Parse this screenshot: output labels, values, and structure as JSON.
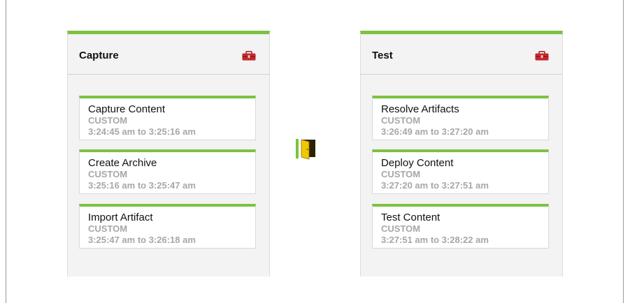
{
  "colors": {
    "accent_green": "#7cc242",
    "panel_bg": "#f3f3f3",
    "muted_text": "#a7a7a7",
    "toolbox_red": "#c8272e",
    "gate_yellow": "#e8c100"
  },
  "icons": {
    "stage_tool": "toolbox-icon",
    "gate": "door-gate-icon"
  },
  "stages": [
    {
      "title": "Capture",
      "jobs": [
        {
          "name": "Capture Content",
          "type": "CUSTOM",
          "time": "3:24:45 am to 3:25:16 am"
        },
        {
          "name": "Create Archive",
          "type": "CUSTOM",
          "time": "3:25:16 am to 3:25:47 am"
        },
        {
          "name": "Import Artifact",
          "type": "CUSTOM",
          "time": "3:25:47 am to 3:26:18 am"
        }
      ]
    },
    {
      "title": "Test",
      "jobs": [
        {
          "name": "Resolve Artifacts",
          "type": "CUSTOM",
          "time": "3:26:49 am to 3:27:20 am"
        },
        {
          "name": "Deploy Content",
          "type": "CUSTOM",
          "time": "3:27:20 am to 3:27:51 am"
        },
        {
          "name": "Test Content",
          "type": "CUSTOM",
          "time": "3:27:51 am to 3:28:22 am"
        }
      ]
    }
  ]
}
